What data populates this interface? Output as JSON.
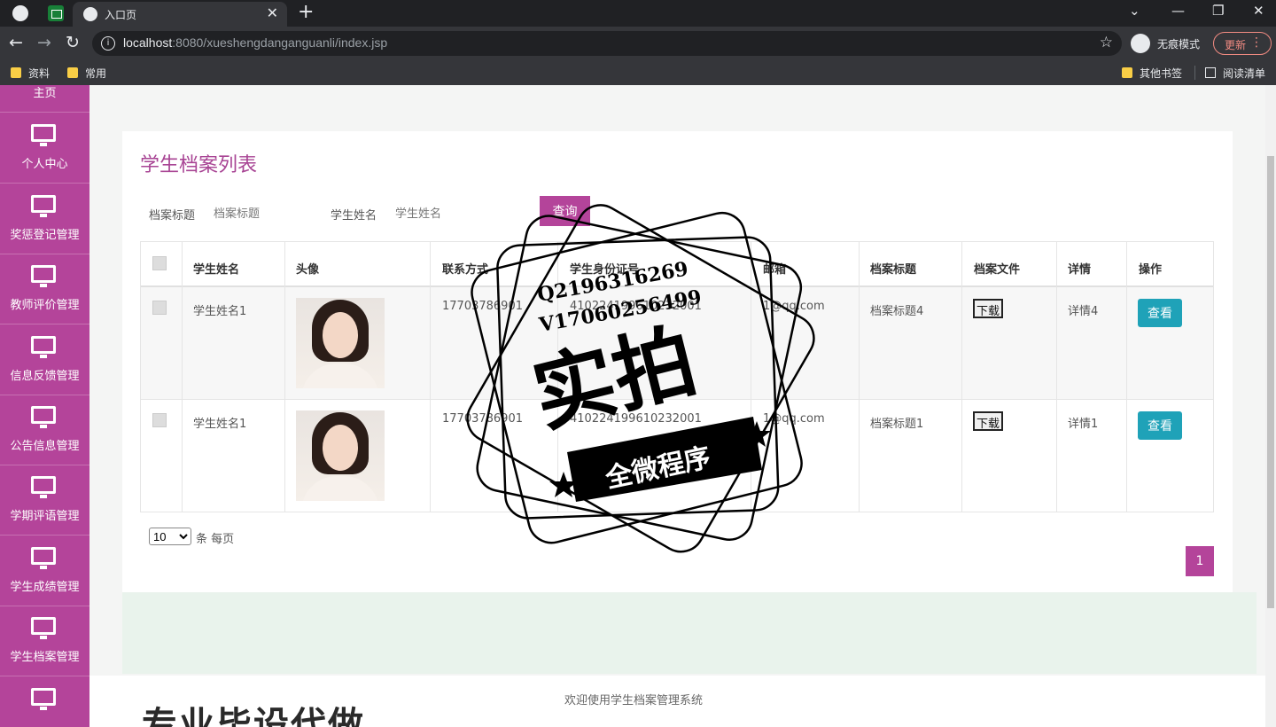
{
  "browser": {
    "tab_title": "入口页",
    "url_host": "localhost",
    "url_rest": ":8080/xueshengdanganguanli/index.jsp",
    "incognito_label": "无痕模式",
    "update_label": "更新",
    "bookmarks": [
      "资料",
      "常用"
    ],
    "bookmarks_right": [
      "其他书签",
      "阅读清单"
    ]
  },
  "sidebar": {
    "items": [
      {
        "label": "主页"
      },
      {
        "label": "个人中心"
      },
      {
        "label": "奖惩登记管理"
      },
      {
        "label": "教师评价管理"
      },
      {
        "label": "信息反馈管理"
      },
      {
        "label": "公告信息管理"
      },
      {
        "label": "学期评语管理"
      },
      {
        "label": "学生成绩管理"
      },
      {
        "label": "学生档案管理"
      }
    ],
    "accent": "#b4449a"
  },
  "page": {
    "title": "学生档案列表",
    "search": {
      "field1_label": "档案标题",
      "field1_placeholder": "档案标题",
      "field2_label": "学生姓名",
      "field2_placeholder": "学生姓名",
      "query_label": "查询"
    }
  },
  "table": {
    "columns": [
      "学生姓名",
      "头像",
      "联系方式",
      "学生身份证号",
      "邮箱",
      "档案标题",
      "档案文件",
      "详情",
      "操作"
    ],
    "rows": [
      {
        "name": "学生姓名1",
        "phone": "17703786901",
        "idcard": "410224199610232001",
        "email": "1@qq.com",
        "title": "档案标题4",
        "file": "下载",
        "detail": "详情4",
        "action": "查看"
      },
      {
        "name": "学生姓名1",
        "phone": "17703786901",
        "idcard": "410224199610232001",
        "email": "1@qq.com",
        "title": "档案标题1",
        "file": "下载",
        "detail": "详情1",
        "action": "查看"
      }
    ]
  },
  "pagination": {
    "per_page_value": "10",
    "per_page_label": "条 每页",
    "current_page": "1"
  },
  "footer": {
    "text": "欢迎使用学生档案管理系统",
    "banner": "专业毕设代做"
  },
  "watermark": {
    "line1": "Q2196316269",
    "line2": "V17060256499",
    "big": "实拍",
    "ribbon": "全微程序"
  },
  "colors": {
    "accent": "#b4449a",
    "view_button": "#1fa2b8"
  }
}
